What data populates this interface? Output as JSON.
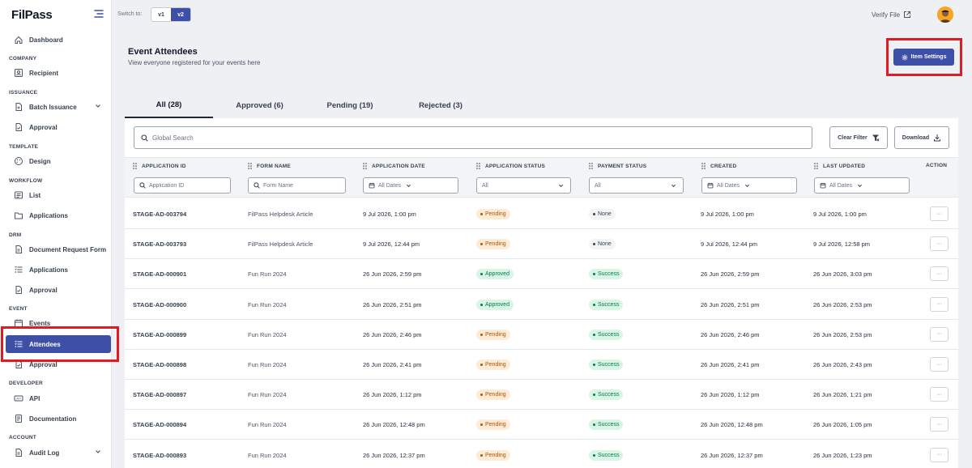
{
  "app": {
    "logo": "FilPass"
  },
  "sidebar": {
    "sections": {
      "company": "COMPANY",
      "issuance": "ISSUANCE",
      "template": "TEMPLATE",
      "workflow": "WORKFLOW",
      "drm": "DRM",
      "event": "EVENT",
      "developer": "DEVELOPER",
      "account": "ACCOUNT"
    },
    "items": {
      "dashboard": "Dashboard",
      "recipient": "Recipient",
      "batch_issuance": "Batch Issuance",
      "approval_issuance": "Approval",
      "design": "Design",
      "list": "List",
      "applications_workflow": "Applications",
      "document_request_form": "Document Request Form",
      "applications_drm": "Applications",
      "approval_drm": "Approval",
      "events": "Events",
      "attendees": "Attendees",
      "approval_event": "Approval",
      "api": "API",
      "documentation": "Documentation",
      "audit_log": "Audit Log"
    }
  },
  "topbar": {
    "switch_label": "Switch to:",
    "v1": "v1",
    "v2": "v2",
    "active_version": "v2",
    "verify_file": "Verify File"
  },
  "page": {
    "title": "Event Attendees",
    "subtitle": "View everyone registered for your events here",
    "item_settings": "Item Settings"
  },
  "tabs": [
    {
      "label": "All (28)",
      "active": true
    },
    {
      "label": "Approved (6)",
      "active": false
    },
    {
      "label": "Pending (19)",
      "active": false
    },
    {
      "label": "Rejected (3)",
      "active": false
    }
  ],
  "toolbar": {
    "search_placeholder": "Global Search",
    "clear_filter": "Clear Filter",
    "download": "Download"
  },
  "table": {
    "columns": {
      "application_id": "APPLICATION ID",
      "form_name": "FORM NAME",
      "application_date": "APPLICATION DATE",
      "application_status": "APPLICATION STATUS",
      "payment_status": "PAYMENT STATUS",
      "created": "CREATED",
      "last_updated": "LAST UPDATED",
      "action": "ACTION"
    },
    "filters": {
      "application_id_placeholder": "Application ID",
      "form_name_placeholder": "Form Name",
      "application_date": "All Dates",
      "application_status": "All",
      "payment_status": "All",
      "created": "All Dates",
      "last_updated": "All Dates"
    },
    "action_label": "···",
    "rows": [
      {
        "id": "STAGE-AD-003794",
        "form": "FilPass Helpdesk Article",
        "app_date": "9 Jul 2026, 1:00 pm",
        "app_status": "Pending",
        "pay_status": "None",
        "created": "9 Jul 2026, 1:00 pm",
        "updated": "9 Jul 2026, 1:00 pm"
      },
      {
        "id": "STAGE-AD-003793",
        "form": "FilPass Helpdesk Article",
        "app_date": "9 Jul 2026, 12:44 pm",
        "app_status": "Pending",
        "pay_status": "None",
        "created": "9 Jul 2026, 12:44 pm",
        "updated": "9 Jul 2026, 12:58 pm"
      },
      {
        "id": "STAGE-AD-000901",
        "form": "Fun Run 2024",
        "app_date": "26 Jun 2026, 2:59 pm",
        "app_status": "Approved",
        "pay_status": "Success",
        "created": "26 Jun 2026, 2:59 pm",
        "updated": "26 Jun 2026, 3:03 pm"
      },
      {
        "id": "STAGE-AD-000900",
        "form": "Fun Run 2024",
        "app_date": "26 Jun 2026, 2:51 pm",
        "app_status": "Approved",
        "pay_status": "Success",
        "created": "26 Jun 2026, 2:51 pm",
        "updated": "26 Jun 2026, 2:53 pm"
      },
      {
        "id": "STAGE-AD-000899",
        "form": "Fun Run 2024",
        "app_date": "26 Jun 2026, 2:46 pm",
        "app_status": "Pending",
        "pay_status": "Success",
        "created": "26 Jun 2026, 2:46 pm",
        "updated": "26 Jun 2026, 2:53 pm"
      },
      {
        "id": "STAGE-AD-000898",
        "form": "Fun Run 2024",
        "app_date": "26 Jun 2026, 2:41 pm",
        "app_status": "Pending",
        "pay_status": "Success",
        "created": "26 Jun 2026, 2:41 pm",
        "updated": "26 Jun 2026, 2:43 pm"
      },
      {
        "id": "STAGE-AD-000897",
        "form": "Fun Run 2024",
        "app_date": "26 Jun 2026, 1:12 pm",
        "app_status": "Pending",
        "pay_status": "Success",
        "created": "26 Jun 2026, 1:12 pm",
        "updated": "26 Jun 2026, 1:21 pm"
      },
      {
        "id": "STAGE-AD-000894",
        "form": "Fun Run 2024",
        "app_date": "26 Jun 2026, 12:48 pm",
        "app_status": "Pending",
        "pay_status": "Success",
        "created": "26 Jun 2026, 12:48 pm",
        "updated": "26 Jun 2026, 1:05 pm"
      },
      {
        "id": "STAGE-AD-000893",
        "form": "Fun Run 2024",
        "app_date": "26 Jun 2026, 12:37 pm",
        "app_status": "Pending",
        "pay_status": "Success",
        "created": "26 Jun 2026, 12:37 pm",
        "updated": "26 Jun 2026, 1:23 pm"
      }
    ]
  },
  "colors": {
    "primary": "#3e4fa7",
    "highlight": "#e01b24",
    "pending_bg": "#fdebd6",
    "pending_fg": "#b45309",
    "success_bg": "#d9f5e3",
    "success_fg": "#047857"
  },
  "icons": [
    "hamburger-icon",
    "dashboard-icon",
    "recipient-icon",
    "batch-issuance-icon",
    "approval-icon",
    "design-icon",
    "list-icon",
    "folder-icon",
    "form-icon",
    "calendar-icon",
    "attendees-icon",
    "api-icon",
    "documentation-icon",
    "audit-log-icon",
    "external-link-icon",
    "gear-icon",
    "search-icon",
    "filter-clear-icon",
    "download-icon",
    "grip-icon",
    "chevron-down-icon"
  ]
}
